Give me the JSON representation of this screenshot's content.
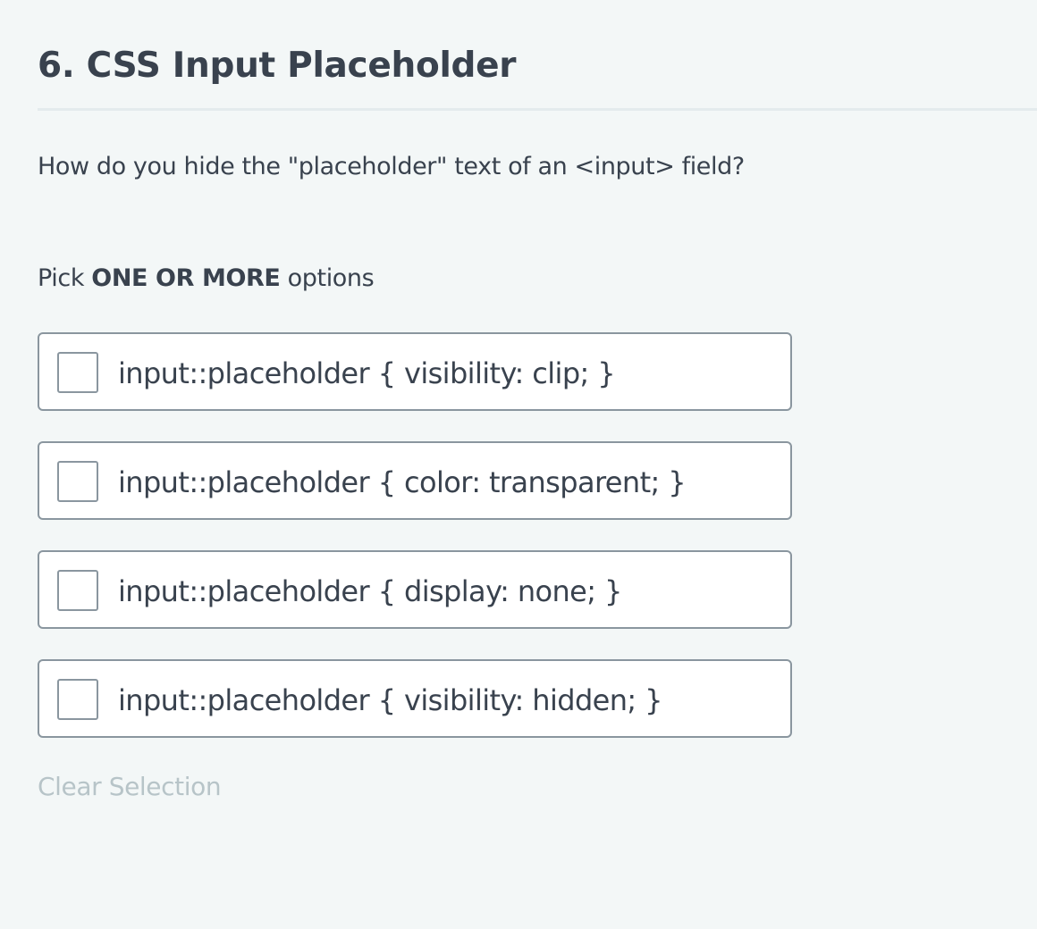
{
  "question": {
    "title": "6. CSS Input Placeholder",
    "text": "How do you hide the \"placeholder\" text of an <input> field?"
  },
  "instruction": {
    "prefix": "Pick ",
    "emphasis": "ONE OR MORE",
    "suffix": " options"
  },
  "options": [
    {
      "label": "input::placeholder { visibility: clip; }",
      "checked": false
    },
    {
      "label": "input::placeholder { color: transparent; }",
      "checked": false
    },
    {
      "label": "input::placeholder { display: none; }",
      "checked": false
    },
    {
      "label": "input::placeholder { visibility: hidden; }",
      "checked": false
    }
  ],
  "actions": {
    "clear_label": "Clear Selection"
  },
  "colors": {
    "background": "#f3f7f7",
    "text": "#39424e",
    "border": "#8a969f",
    "disabled_text": "#b7c4c8"
  }
}
